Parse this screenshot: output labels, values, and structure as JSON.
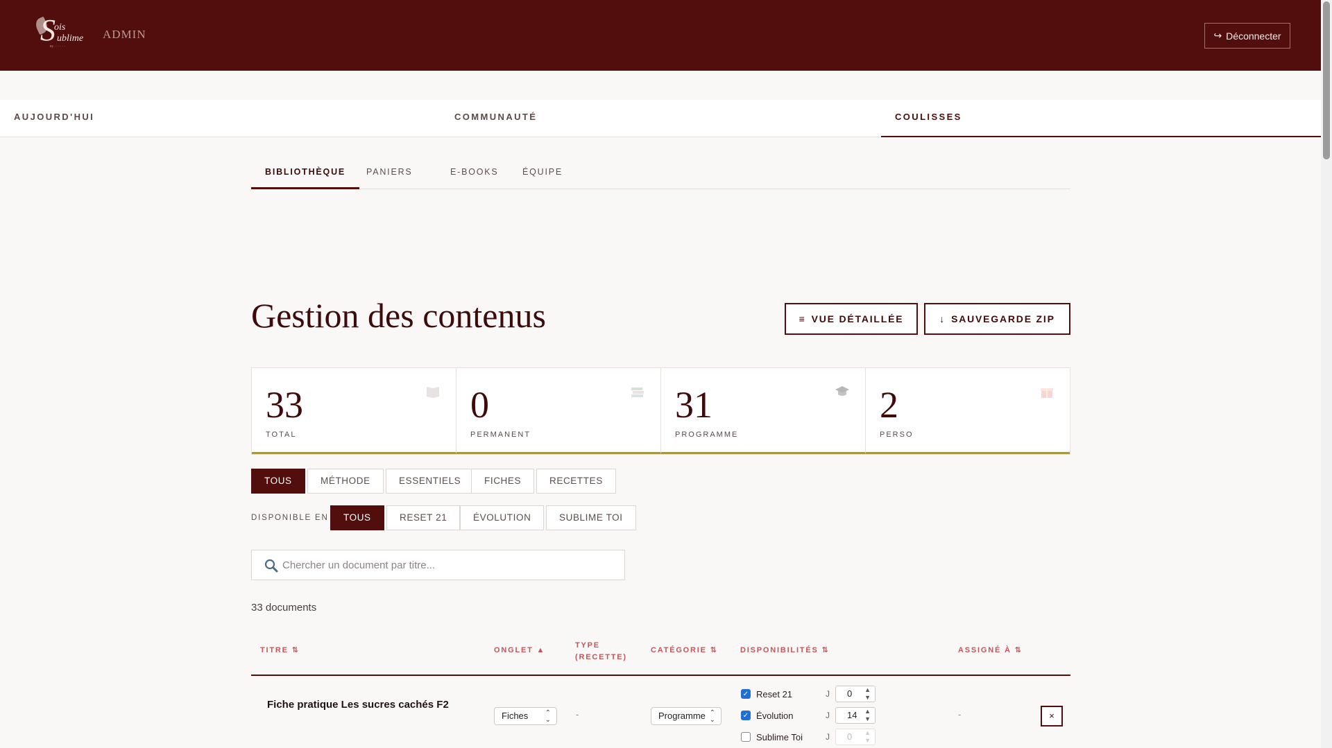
{
  "header": {
    "logo_text": "Sois Sublime",
    "admin_label": "ADMIN",
    "logout_label": "Déconnecter",
    "logout_icon": "logout-arrow-icon"
  },
  "main_nav": {
    "items": [
      {
        "label": "AUJOURD'HUI",
        "active": false
      },
      {
        "label": "COMMUNAUTÉ",
        "active": false
      },
      {
        "label": "COULISSES",
        "active": true
      }
    ]
  },
  "sub_tabs": {
    "items": [
      {
        "label": "BIBLIOTHÈQUE",
        "active": true
      },
      {
        "label": "PANIERS",
        "active": false
      },
      {
        "label": "E-BOOKS",
        "active": false
      },
      {
        "label": "ÉQUIPE",
        "active": false
      }
    ]
  },
  "page": {
    "title": "Gestion des contenus",
    "detail_view_label": "VUE DÉTAILLÉE",
    "detail_view_icon": "≡",
    "zip_backup_label": "SAUVEGARDE ZIP",
    "zip_backup_icon": "↓"
  },
  "stats": [
    {
      "value": "33",
      "label": "TOTAL",
      "icon": "book-icon"
    },
    {
      "value": "0",
      "label": "PERMANENT",
      "icon": "books-stack-icon"
    },
    {
      "value": "31",
      "label": "PROGRAMME",
      "icon": "graduation-cap-icon"
    },
    {
      "value": "2",
      "label": "PERSO",
      "icon": "gift-icon"
    }
  ],
  "type_filters": {
    "items": [
      {
        "label": "TOUS",
        "active": true
      },
      {
        "label": "MÉTHODE",
        "active": false
      },
      {
        "label": "ESSENTIELS",
        "active": false
      },
      {
        "label": "FICHES",
        "active": false
      },
      {
        "label": "RECETTES",
        "active": false
      }
    ]
  },
  "availability_filters": {
    "label": "DISPONIBLE EN",
    "items": [
      {
        "label": "TOUS",
        "active": true
      },
      {
        "label": "RESET 21",
        "active": false
      },
      {
        "label": "ÉVOLUTION",
        "active": false
      },
      {
        "label": "SUBLIME TOI",
        "active": false
      }
    ]
  },
  "search": {
    "placeholder": "Chercher un document par titre...",
    "value": ""
  },
  "doc_count": "33 documents",
  "table": {
    "columns": [
      {
        "label": "TITRE ⇅"
      },
      {
        "label": "ONGLET ▲"
      },
      {
        "label": "TYPE",
        "label2": "(RECETTE)"
      },
      {
        "label": "CATÉGORIE ⇅"
      },
      {
        "label": "DISPONIBILITÉS ⇅"
      },
      {
        "label": "ASSIGNÉ À ⇅"
      }
    ],
    "rows": [
      {
        "title": "Fiche pratique Les sucres cachés F2",
        "onglet": "Fiches",
        "type": "-",
        "categorie": "Programme",
        "disponibilites": [
          {
            "name": "Reset 21",
            "checked": true,
            "j_label": "J",
            "j_value": "0",
            "enabled": true
          },
          {
            "name": "Évolution",
            "checked": true,
            "j_label": "J",
            "j_value": "14",
            "enabled": true
          },
          {
            "name": "Sublime Toi",
            "checked": false,
            "j_label": "J",
            "j_value": "0",
            "enabled": false
          }
        ],
        "assigne": "-",
        "delete_label": "×"
      }
    ]
  },
  "colors": {
    "brand": "#520d0d",
    "accent_gold": "#a89640",
    "header_text": "#c0555a",
    "checkbox_blue": "#1f6fd6"
  }
}
